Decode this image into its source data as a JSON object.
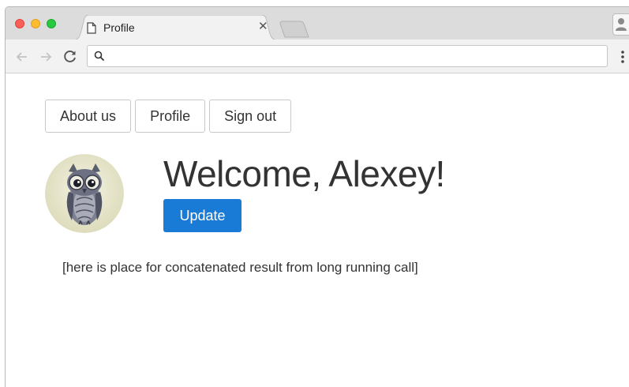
{
  "browser": {
    "tab": {
      "title": "Profile"
    },
    "omnibox": {
      "value": "",
      "placeholder": ""
    }
  },
  "nav": {
    "buttons": [
      {
        "label": "About us"
      },
      {
        "label": "Profile"
      },
      {
        "label": "Sign out"
      }
    ]
  },
  "profile": {
    "welcome": "Welcome, Alexey!",
    "update_label": "Update",
    "result_text": "[here is place for concatenated result from long running call]"
  },
  "icons": {
    "tab_icon": "document-icon",
    "tab_close": "close-icon",
    "back": "arrow-left-icon",
    "forward": "arrow-right-icon",
    "reload": "reload-icon",
    "search": "search-icon",
    "menu": "vertical-dots-icon",
    "profile": "person-icon",
    "avatar": "owl-avatar-icon"
  },
  "colors": {
    "primary": "#1a7bd6",
    "text": "#333333",
    "traffic_red": "#fc5f57",
    "traffic_yellow": "#fdbc2e",
    "traffic_green": "#28c840"
  }
}
